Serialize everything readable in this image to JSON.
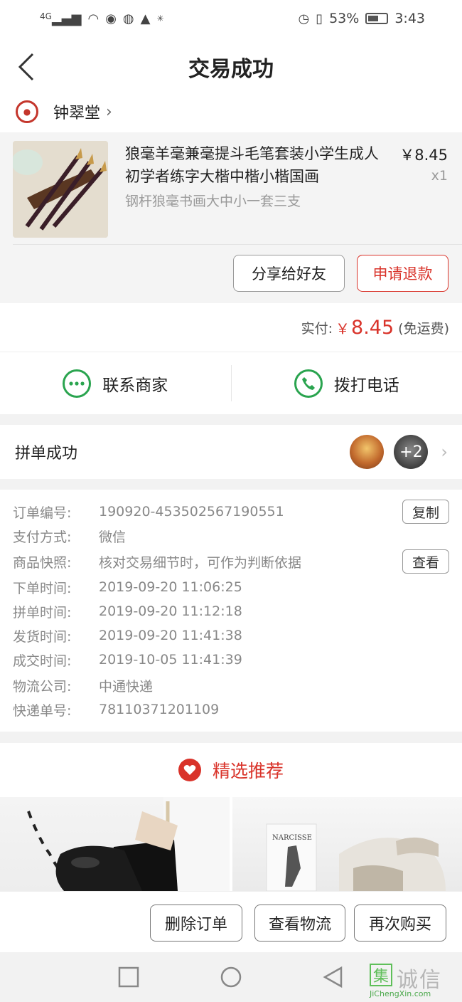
{
  "status_bar": {
    "network": "4G",
    "battery": "53%",
    "time": "3:43"
  },
  "header": {
    "title": "交易成功"
  },
  "store": {
    "name": "钟翠堂"
  },
  "product": {
    "title": "狼毫羊毫兼毫提斗毛笔套装小学生成人初学者练字大楷中楷小楷国画",
    "sku": "钢杆狼毫书画大中小一套三支",
    "price": "￥8.45",
    "quantity": "x1",
    "share_label": "分享给好友",
    "refund_label": "申请退款"
  },
  "payment": {
    "paid_label": "实付:",
    "currency": "￥",
    "amount": "8.45",
    "shipping_note": "(免运费)"
  },
  "contact": {
    "merchant_label": "联系商家",
    "call_label": "拨打电话"
  },
  "group": {
    "label": "拼单成功",
    "more_count": "+2"
  },
  "order_details": [
    {
      "key": "订单编号:",
      "value": "190920-453502567190551"
    },
    {
      "key": "支付方式:",
      "value": "微信"
    },
    {
      "key": "商品快照:",
      "value": "核对交易细节时，可作为判断依据"
    },
    {
      "key": "下单时间:",
      "value": "2019-09-20 11:06:25"
    },
    {
      "key": "拼单时间:",
      "value": "2019-09-20 11:12:18"
    },
    {
      "key": "发货时间:",
      "value": "2019-09-20 11:41:38"
    },
    {
      "key": "成交时间:",
      "value": "2019-10-05 11:41:39"
    },
    {
      "key": "物流公司:",
      "value": "中通快递"
    },
    {
      "key": "快递单号:",
      "value": "78110371201109"
    }
  ],
  "detail_actions": {
    "copy_label": "复制",
    "view_label": "查看"
  },
  "recommend": {
    "title": "精选推荐"
  },
  "actions": {
    "delete_label": "删除订单",
    "logistics_label": "查看物流",
    "rebuy_label": "再次购买"
  },
  "watermark": {
    "glyph": "集",
    "text": "诚信",
    "url": "JiChengXin.com"
  },
  "colors": {
    "accent_red": "#d9332a",
    "contact_green": "#2aa44f"
  }
}
